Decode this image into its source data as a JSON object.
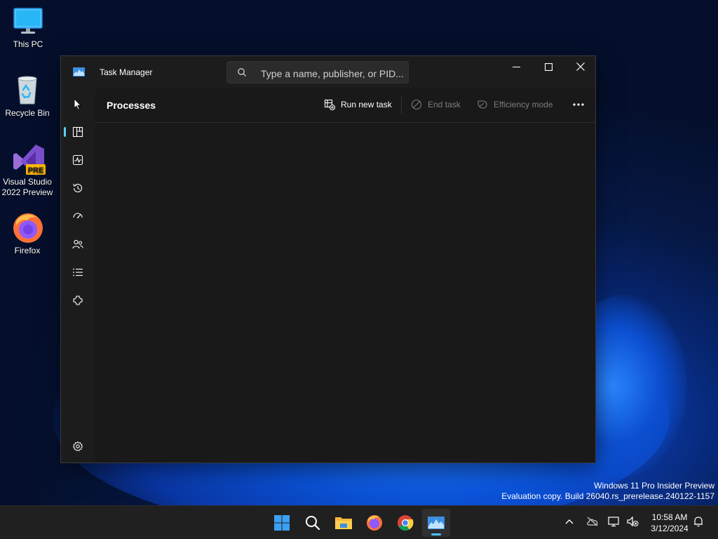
{
  "desktop": {
    "icons": [
      {
        "label": "This PC"
      },
      {
        "label": "Recycle Bin"
      },
      {
        "label_line1": "Visual Studio",
        "label_line2": "2022 Preview",
        "badge": "PRE"
      },
      {
        "label": "Firefox"
      }
    ],
    "watermark": {
      "line1": "Windows 11 Pro Insider Preview",
      "line2": "Evaluation copy. Build 26040.rs_prerelease.240122-1157"
    }
  },
  "window": {
    "title": "Task Manager",
    "search_placeholder": "Type a name, publisher, or PID...",
    "page_title": "Processes",
    "commands": {
      "run_new_task": "Run new task",
      "end_task": "End task",
      "efficiency_mode": "Efficiency mode"
    },
    "nav": [
      {
        "id": "hamburger",
        "icon": "hamburger-icon"
      },
      {
        "id": "processes",
        "icon": "processes-icon",
        "active": true
      },
      {
        "id": "performance",
        "icon": "performance-icon"
      },
      {
        "id": "app-history",
        "icon": "history-icon"
      },
      {
        "id": "startup-apps",
        "icon": "startup-icon"
      },
      {
        "id": "users",
        "icon": "users-icon"
      },
      {
        "id": "details",
        "icon": "details-icon"
      },
      {
        "id": "services",
        "icon": "services-icon"
      },
      {
        "id": "settings",
        "icon": "gear-icon"
      }
    ]
  },
  "taskbar": {
    "clock_time": "10:58 AM",
    "clock_date": "3/12/2024"
  },
  "colors": {
    "accent": "#60cdff",
    "window_bg": "#1c1c1c",
    "taskbar_bg": "#202020"
  }
}
